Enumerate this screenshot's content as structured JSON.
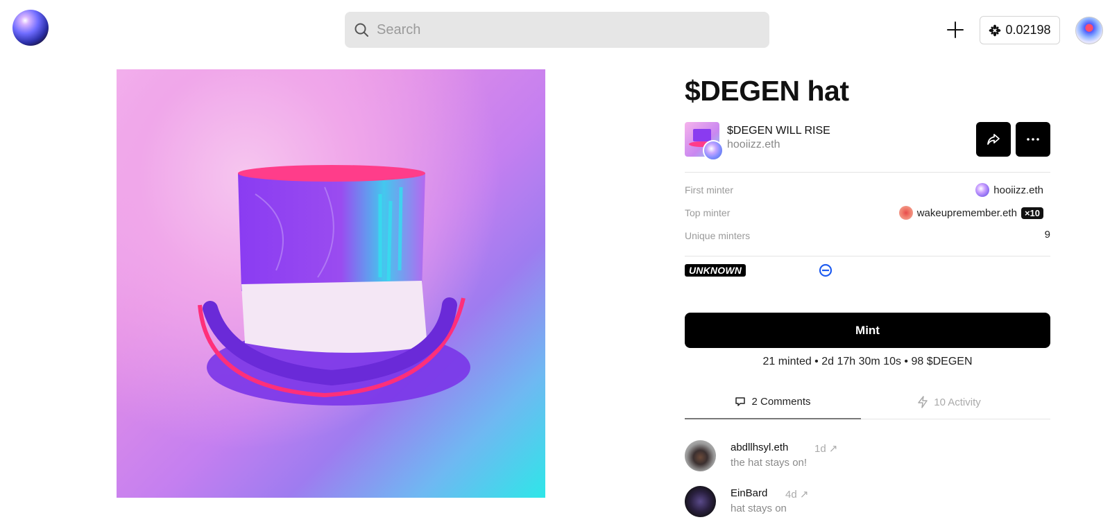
{
  "header": {
    "search_placeholder": "Search",
    "balance": "0.02198"
  },
  "token": {
    "title": "$DEGEN hat",
    "collection_name": "$DEGEN WILL RISE",
    "creator": "hooiizz.eth"
  },
  "stats": {
    "first_minter_label": "First minter",
    "first_minter": "hooiizz.eth",
    "top_minter_label": "Top minter",
    "top_minter": "wakeupremember.eth",
    "top_minter_count": "×10",
    "unique_minters_label": "Unique minters",
    "unique_minters": "9"
  },
  "license_badge": "UNKNOWN",
  "mint": {
    "button_label": "Mint",
    "info": "21 minted • 2d 17h 30m 10s • 98 $DEGEN"
  },
  "tabs": {
    "comments": "2 Comments",
    "activity": "10 Activity"
  },
  "comments": [
    {
      "user": "abdllhsyl.eth",
      "time": "1d ↗",
      "text": "the hat stays on!"
    },
    {
      "user": "EinBard",
      "time": "4d ↗",
      "text": "hat stays on"
    }
  ],
  "colors": {
    "accent": "#000000",
    "chain_icon": "#1f5cf0"
  },
  "icons": {
    "search": "search-icon",
    "plus": "plus-icon",
    "balance": "asterisk-icon",
    "share": "share-icon",
    "more": "more-icon",
    "chain": "chain-icon",
    "comments": "comment-icon",
    "activity": "lightning-icon"
  }
}
